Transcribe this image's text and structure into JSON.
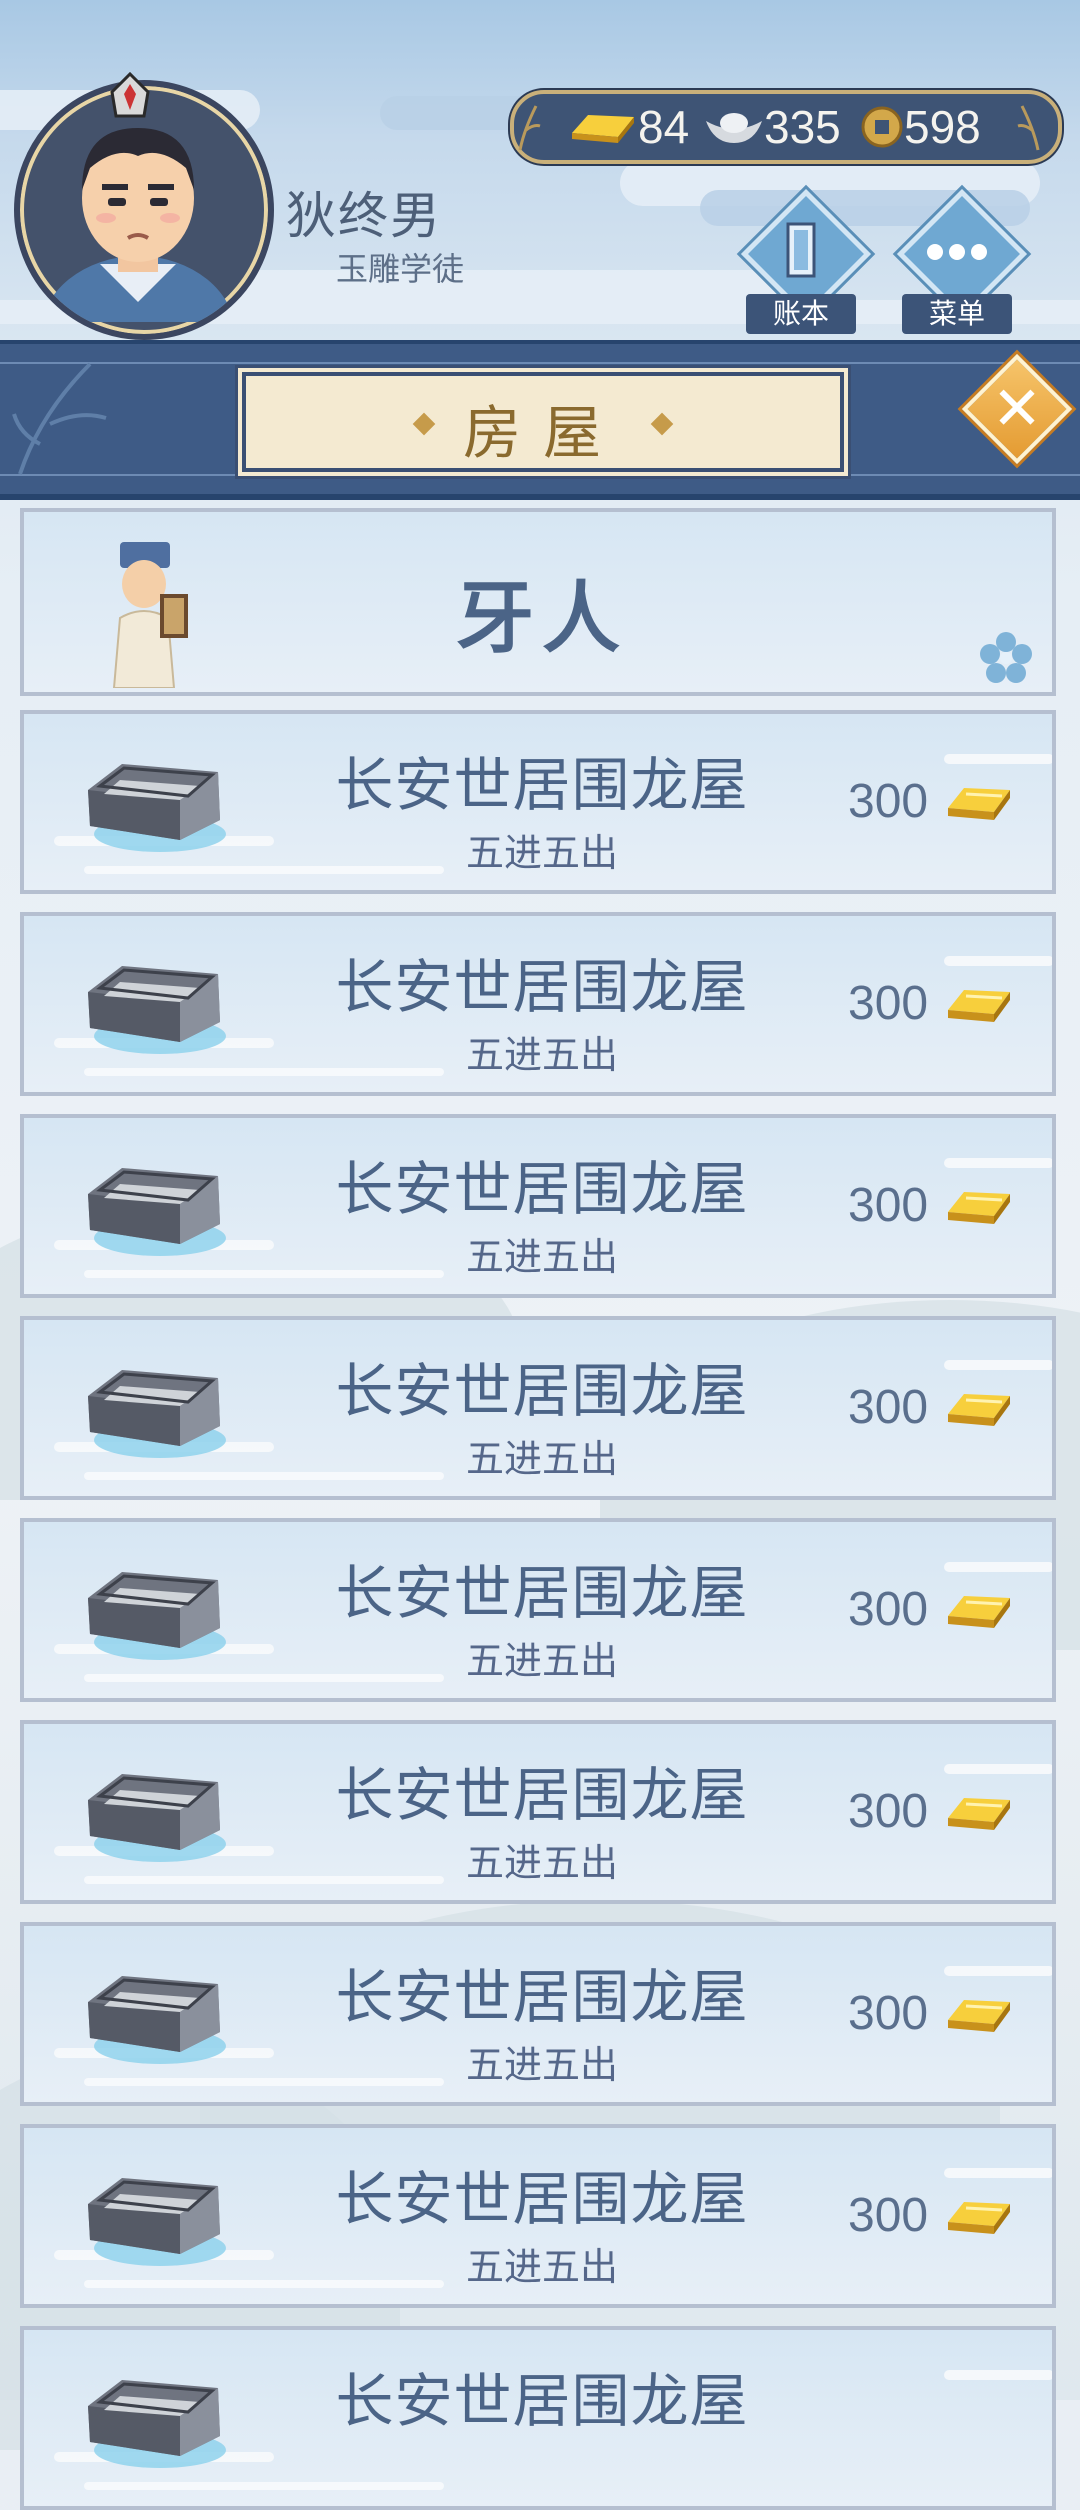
{
  "player": {
    "name": "狄终男",
    "title": "玉雕学徒"
  },
  "currency": {
    "gold": "84",
    "silver": "335",
    "coin": "598"
  },
  "header_buttons": {
    "ledger": "账本",
    "menu": "菜单"
  },
  "panel": {
    "title": "房屋"
  },
  "agent": {
    "label": "牙人"
  },
  "houses": [
    {
      "name": "长安世居围龙屋",
      "desc": "五进五出",
      "price": "300"
    },
    {
      "name": "长安世居围龙屋",
      "desc": "五进五出",
      "price": "300"
    },
    {
      "name": "长安世居围龙屋",
      "desc": "五进五出",
      "price": "300"
    },
    {
      "name": "长安世居围龙屋",
      "desc": "五进五出",
      "price": "300"
    },
    {
      "name": "长安世居围龙屋",
      "desc": "五进五出",
      "price": "300"
    },
    {
      "name": "长安世居围龙屋",
      "desc": "五进五出",
      "price": "300"
    },
    {
      "name": "长安世居围龙屋",
      "desc": "五进五出",
      "price": "300"
    },
    {
      "name": "长安世居围龙屋",
      "desc": "五进五出",
      "price": "300"
    },
    {
      "name": "长安世居围龙屋",
      "desc": "",
      "price": ""
    }
  ],
  "colors": {
    "navy": "#3e5b86",
    "plaque": "#f4ead1",
    "text_blue": "#4b6487",
    "gold": "#e8b623"
  },
  "icons": {
    "currency": [
      "gold-ingot-icon",
      "silver-ingot-icon",
      "copper-coin-icon"
    ],
    "close": "close-icon",
    "ledger": "ledger-icon",
    "menu": "menu-dots-icon"
  }
}
